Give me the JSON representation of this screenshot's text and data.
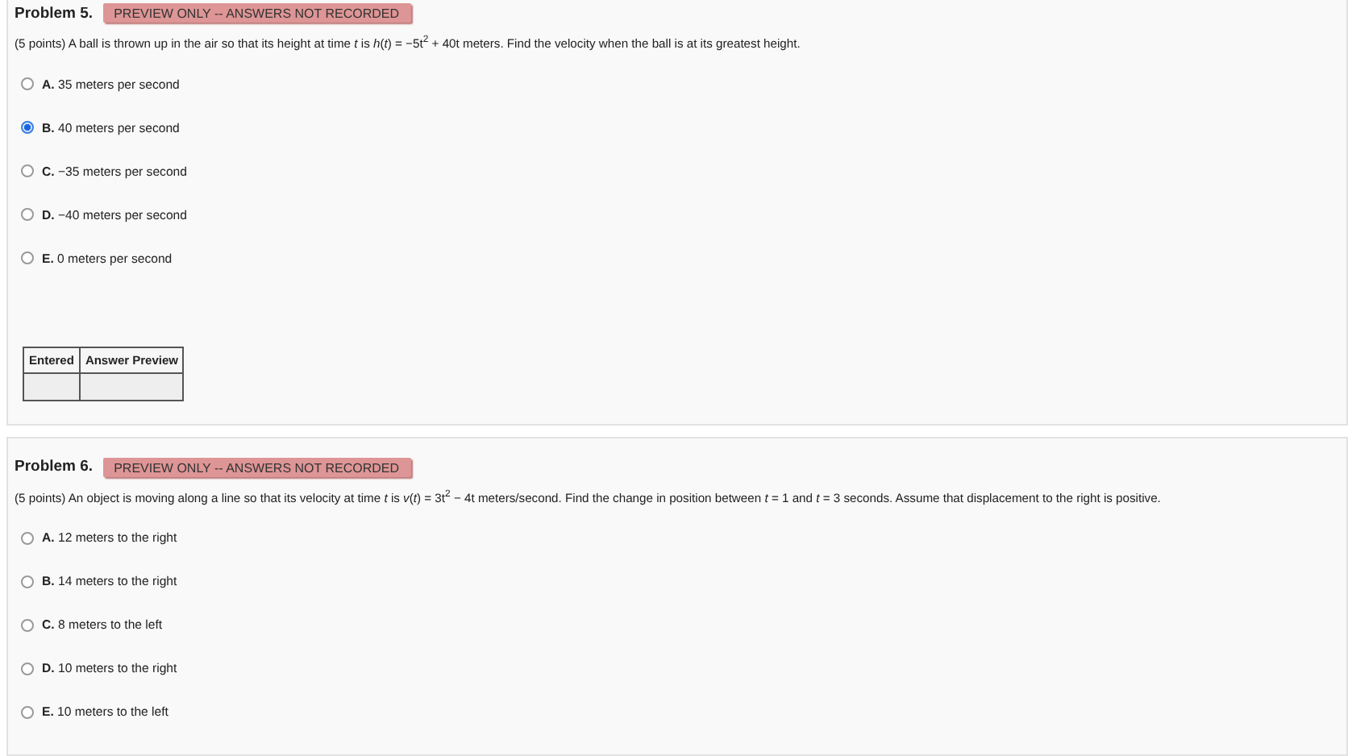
{
  "problems": [
    {
      "title": "Problem 5.",
      "badge": "PREVIEW ONLY -- ANSWERS NOT RECORDED",
      "statement": "(5 points) A ball is thrown up in the air so that its height at time *t* is *h*(*t*) = −5t$^{2}$ + 40t meters. Find the velocity when the ball is at its greatest height.",
      "options": [
        {
          "label": "A.",
          "text": "35 meters per second",
          "selected": false
        },
        {
          "label": "B.",
          "text": "40 meters per second",
          "selected": true
        },
        {
          "label": "C.",
          "text": "−35 meters per second",
          "selected": false
        },
        {
          "label": "D.",
          "text": "−40 meters per second",
          "selected": false
        },
        {
          "label": "E.",
          "text": "0 meters per second",
          "selected": false
        }
      ],
      "answer_table": {
        "columns": [
          "Entered",
          "Answer Preview"
        ]
      }
    },
    {
      "title": "Problem 6.",
      "badge": "PREVIEW ONLY -- ANSWERS NOT RECORDED",
      "statement": "(5 points) An object is moving along a line so that its velocity at time *t* is *v*(*t*) = 3t$^{2}$ − 4t meters/second. Find the change in position between *t* = 1 and *t* = 3 seconds. Assume that displacement to the right is positive.",
      "options": [
        {
          "label": "A.",
          "text": "12 meters to the right",
          "selected": false
        },
        {
          "label": "B.",
          "text": "14 meters to the right",
          "selected": false
        },
        {
          "label": "C.",
          "text": "8 meters to the left",
          "selected": false
        },
        {
          "label": "D.",
          "text": "10 meters to the right",
          "selected": false
        },
        {
          "label": "E.",
          "text": "10 meters to the left",
          "selected": false
        }
      ]
    }
  ]
}
